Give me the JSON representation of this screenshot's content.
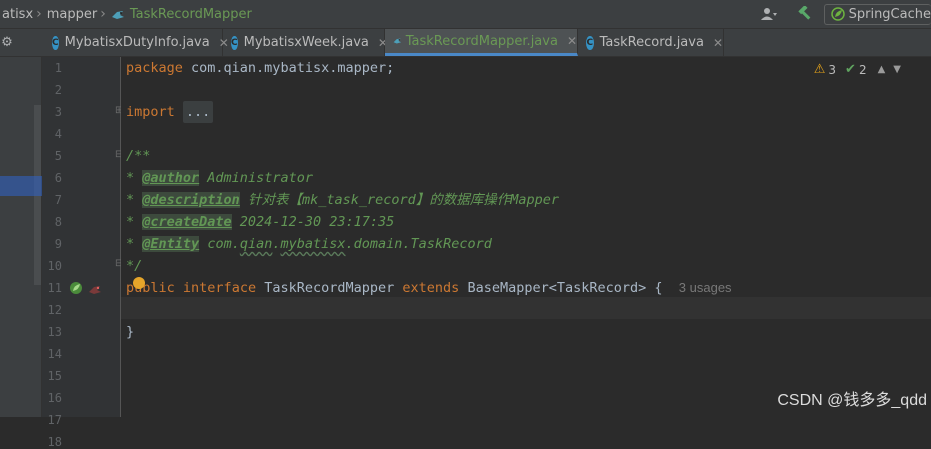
{
  "breadcrumb": {
    "items": [
      "atisx",
      "mapper",
      "TaskRecordMapper"
    ]
  },
  "toolbar": {
    "run_config": "SpringCache"
  },
  "tabs": [
    {
      "label": "MybatisxDutyInfo.java",
      "icon": "class-icon",
      "active": false
    },
    {
      "label": "MybatisxWeek.java",
      "icon": "class-icon",
      "active": false
    },
    {
      "label": "TaskRecordMapper.java",
      "icon": "mapper-icon",
      "active": true
    },
    {
      "label": "TaskRecord.java",
      "icon": "class-icon",
      "active": false
    }
  ],
  "inspections": {
    "warnings": "3",
    "weak_warnings": "2"
  },
  "line_numbers": [
    "1",
    "2",
    "3",
    "4",
    "5",
    "6",
    "7",
    "8",
    "9",
    "10",
    "11",
    "12",
    "13",
    "14",
    "15",
    "16",
    "17",
    "18"
  ],
  "code": {
    "l1_kw": "package",
    "l1_rest": " com.qian.mybatisx.mapper;",
    "l3_kw": "import",
    "l3_fold": "...",
    "l6": "/**",
    "star": "* ",
    "l7_tag": "@author",
    "l7_text": " Administrator",
    "l8_tag": "@description",
    "l8_text": " 针对表【mk_task_record】的数据库操作Mapper",
    "l9_tag": "@createDate",
    "l9_text": " 2024-12-30 23:17:35",
    "l10_tag": "@Entity",
    "l10_pre": " ",
    "l10_ref1": "com",
    "l10_dot1": ".",
    "l10_ref2": "qian",
    "l10_dot2": ".",
    "l10_ref3": "mybatisx",
    "l10_rest": ".domain.TaskRecord",
    "l11": "*/",
    "l12_kw1": "public",
    "l12_kw2": "interface",
    "l12_name": "TaskRecordMapper",
    "l12_kw3": "extends",
    "l12_base": "BaseMapper<TaskRecord> {",
    "l12_usages": "3 usages",
    "l14": "}"
  },
  "watermark": "CSDN @钱多多_qdd",
  "colors": {
    "keyword": "#cc7832",
    "comment": "#629755",
    "accent": "#4a88c7"
  }
}
